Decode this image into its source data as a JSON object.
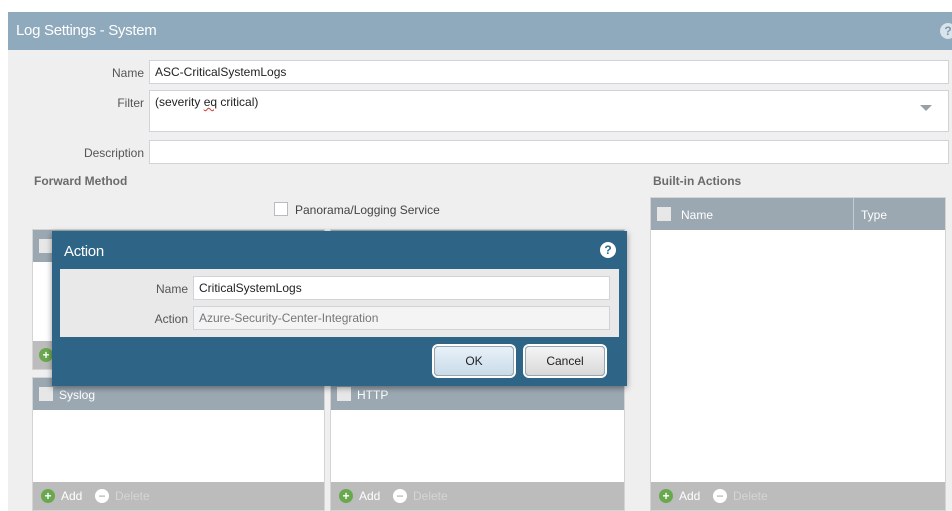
{
  "window": {
    "title": "Log Settings - System",
    "help": "?"
  },
  "form": {
    "name_label": "Name",
    "name_value": "ASC-CriticalSystemLogs",
    "filter_label": "Filter",
    "filter_prefix": "(severity ",
    "filter_op": "eq",
    "filter_suffix": " critical)",
    "description_label": "Description",
    "description_value": ""
  },
  "forward_method": {
    "title": "Forward Method",
    "panorama_label": "Panorama/Logging Service",
    "syslog_label": "Syslog",
    "http_label": "HTTP"
  },
  "builtin": {
    "title": "Built-in Actions",
    "columns": [
      "Name",
      "Type"
    ]
  },
  "footer": {
    "add": "Add",
    "delete": "Delete"
  },
  "modal": {
    "title": "Action",
    "help": "?",
    "name_label": "Name",
    "name_value": "CriticalSystemLogs",
    "action_label": "Action",
    "action_value": "Azure-Security-Center-Integration",
    "ok": "OK",
    "cancel": "Cancel"
  },
  "icons": {
    "add": "plus-circle-icon",
    "delete": "minus-circle-icon",
    "help": "help-icon"
  },
  "colors": {
    "title_bar": "#8fa9bd",
    "modal_bg": "#2e6486",
    "add_green": "#6aa84f"
  }
}
